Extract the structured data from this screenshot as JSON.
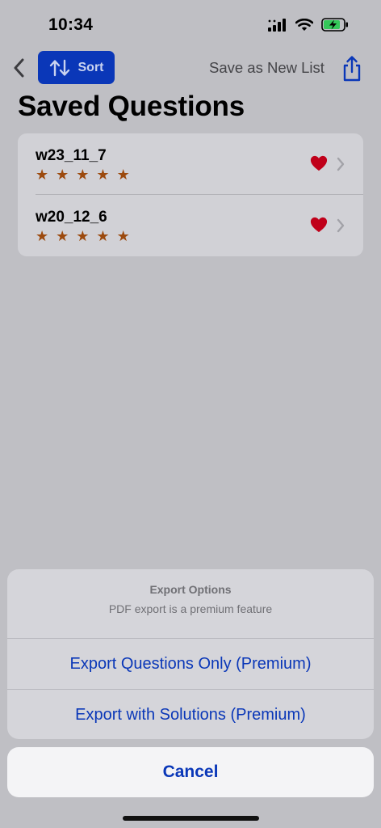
{
  "status_bar": {
    "time": "10:34"
  },
  "nav": {
    "sort_label": "Sort",
    "save_new_label": "Save as New List"
  },
  "page": {
    "title": "Saved Questions"
  },
  "list": {
    "items": [
      {
        "title": "w23_11_7",
        "rating": 5,
        "stars": "★ ★ ★ ★ ★",
        "favorite": true
      },
      {
        "title": "w20_12_6",
        "rating": 5,
        "stars": "★ ★ ★ ★ ★",
        "favorite": true
      }
    ]
  },
  "sheet": {
    "title": "Export Options",
    "subtitle": "PDF export is a premium feature",
    "options": [
      {
        "label": "Export Questions Only (Premium)"
      },
      {
        "label": "Export with Solutions (Premium)"
      }
    ],
    "cancel_label": "Cancel"
  },
  "colors": {
    "accent": "#0a37b8",
    "star": "#9c4a0e",
    "heart": "#c0001a",
    "battery_fill": "#34c759"
  }
}
